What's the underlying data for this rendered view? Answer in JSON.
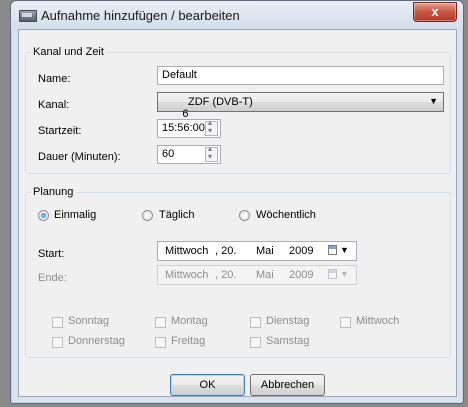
{
  "window": {
    "title": "Aufnahme hinzufügen / bearbeiten",
    "close_symbol": "x",
    "icon": "app-window-icon"
  },
  "kanal_und_zeit": {
    "group_title": "Kanal und Zeit",
    "name_label": "Name:",
    "name_value": "Default",
    "kanal_label": "Kanal:",
    "kanal_number": "6",
    "kanal_value": "ZDF (DVB-T)",
    "startzeit_label": "Startzeit:",
    "startzeit_value": "15:56:00",
    "dauer_label": "Dauer (Minuten):",
    "dauer_value": "60"
  },
  "planung": {
    "group_title": "Planung",
    "radios": [
      {
        "label": "Einmalig",
        "selected": true
      },
      {
        "label": "Täglich",
        "selected": false
      },
      {
        "label": "Wöchentlich",
        "selected": false
      }
    ],
    "start_label": "Start:",
    "start_date": {
      "weekday": "Mittwoch",
      "day": ", 20.",
      "month": "Mai",
      "year": "2009"
    },
    "ende_label": "Ende:",
    "ende_date": {
      "weekday": "Mittwoch",
      "day": ", 20.",
      "month": "Mai",
      "year": "2009"
    },
    "weekdays": [
      "Sonntag",
      "Montag",
      "Dienstag",
      "Mittwoch",
      "Donnerstag",
      "Freitag",
      "Samstag"
    ]
  },
  "buttons": {
    "ok": "OK",
    "cancel": "Abbrechen"
  },
  "colors": {
    "titlebar": "#d4dde9",
    "client_bg": "#f0f0f0",
    "close_button": "#c75443",
    "default_button_border": "#3c7fb1"
  }
}
